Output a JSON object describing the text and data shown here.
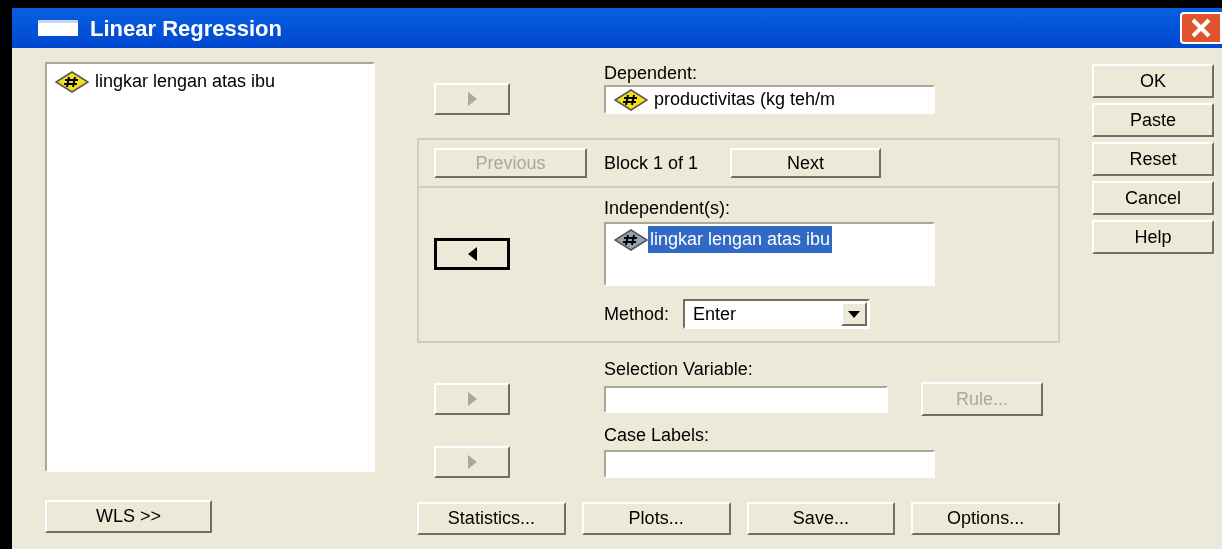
{
  "window": {
    "title": "Linear Regression"
  },
  "variable_list": {
    "items": [
      {
        "label": "lingkar lengan atas ibu"
      }
    ]
  },
  "dependent": {
    "label": "Dependent:",
    "value": "productivitas (kg teh/m"
  },
  "block": {
    "previous": {
      "label": "Previous",
      "disabled": true
    },
    "text": "Block 1 of 1",
    "next": {
      "label": "Next",
      "disabled": false
    }
  },
  "independents": {
    "label": "Independent(s):",
    "items": [
      {
        "label": "lingkar lengan atas ibu",
        "selected": true
      }
    ]
  },
  "method": {
    "label": "Method:",
    "value": "Enter"
  },
  "selection_variable": {
    "label": "Selection Variable:",
    "rule": {
      "label": "Rule...",
      "disabled": true
    }
  },
  "case_labels": {
    "label": "Case Labels:"
  },
  "arrows": [
    {
      "kind": "right",
      "disabled": true
    },
    {
      "kind": "left",
      "disabled": false
    },
    {
      "kind": "right",
      "disabled": true
    },
    {
      "kind": "right",
      "disabled": true
    }
  ],
  "side_buttons": [
    "OK",
    "Paste",
    "Reset",
    "Cancel",
    "Help"
  ],
  "bottom_buttons": [
    "Statistics...",
    "Plots...",
    "Save...",
    "Options..."
  ],
  "wls_button": "WLS >>"
}
